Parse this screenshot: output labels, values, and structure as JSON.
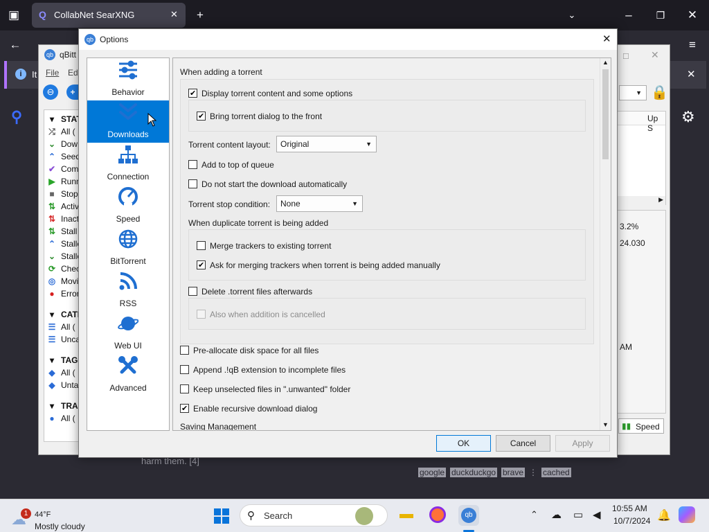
{
  "browser": {
    "tab_title": "CollabNet SearXNG",
    "notice_text": "It",
    "page_fragment": "harm them. [4]",
    "engines": [
      "google",
      "duckduckgo",
      "brave",
      "⋮",
      "cached"
    ]
  },
  "qbt": {
    "title": "qBitt",
    "menu": [
      "File",
      "Edi"
    ],
    "status_header": "STATU",
    "status_items": [
      {
        "icon": "⤮",
        "label": "All (",
        "color": "#555"
      },
      {
        "icon": "⌄",
        "label": "Dow",
        "color": "#2e8b2e"
      },
      {
        "icon": "⌃",
        "label": "Seed",
        "color": "#2a6bd6"
      },
      {
        "icon": "✔",
        "label": "Com",
        "color": "#8a4fd6"
      },
      {
        "icon": "▶",
        "label": "Runn",
        "color": "#2aa52a"
      },
      {
        "icon": "■",
        "label": "Stop",
        "color": "#666"
      },
      {
        "icon": "⇅",
        "label": "Activ",
        "color": "#2a9a2a"
      },
      {
        "icon": "⇅",
        "label": "Inact",
        "color": "#d62a2a"
      },
      {
        "icon": "⇅",
        "label": "Stall",
        "color": "#2a9a2a"
      },
      {
        "icon": "⌃",
        "label": "Stalle",
        "color": "#2a6bd6"
      },
      {
        "icon": "⌄",
        "label": "Stalle",
        "color": "#2e8b2e"
      },
      {
        "icon": "⟳",
        "label": "Chec",
        "color": "#2a9a2a"
      },
      {
        "icon": "◎",
        "label": "Movi",
        "color": "#2a6bd6"
      },
      {
        "icon": "●",
        "label": "Error",
        "color": "#d61f1f"
      }
    ],
    "categories_header": "CATEG",
    "category_items": [
      "All (",
      "Unca"
    ],
    "tags_header": "TAGS",
    "tag_items": [
      "All (",
      "Unta"
    ],
    "trackers_header": "TRACK",
    "tracker_items": [
      "All ("
    ],
    "column_up": "Up S",
    "stat_percent": "3.2%",
    "stat_value": "24.030",
    "stat_time": "AM",
    "speed_label": "Speed"
  },
  "dialog": {
    "title": "Options",
    "close_glyph": "✕",
    "sidebar": [
      {
        "label": "Behavior",
        "icon": "sliders-icon",
        "active": false
      },
      {
        "label": "Downloads",
        "icon": "double-chevron-down-icon",
        "active": true
      },
      {
        "label": "Connection",
        "icon": "network-icon",
        "active": false
      },
      {
        "label": "Speed",
        "icon": "speedometer-icon",
        "active": false
      },
      {
        "label": "BitTorrent",
        "icon": "globe-icon",
        "active": false
      },
      {
        "label": "RSS",
        "icon": "rss-icon",
        "active": false
      },
      {
        "label": "Web UI",
        "icon": "planet-icon",
        "active": false
      },
      {
        "label": "Advanced",
        "icon": "tools-icon",
        "active": false
      }
    ],
    "section_adding": "When adding a torrent",
    "opt_display_content": {
      "label": "Display torrent content and some options",
      "checked": true
    },
    "opt_bring_front": {
      "label": "Bring torrent dialog to the front",
      "checked": true
    },
    "layout_label": "Torrent content layout:",
    "layout_value": "Original",
    "opt_top_queue": {
      "label": "Add to top of queue",
      "checked": false
    },
    "opt_no_start": {
      "label": "Do not start the download automatically",
      "checked": false
    },
    "stop_label": "Torrent stop condition:",
    "stop_value": "None",
    "duplicate_label": "When duplicate torrent is being added",
    "opt_merge": {
      "label": "Merge trackers to existing torrent",
      "checked": false
    },
    "opt_ask_merge": {
      "label": "Ask for merging trackers when torrent is being added manually",
      "checked": true
    },
    "opt_delete_files": {
      "label": "Delete .torrent files afterwards",
      "checked": false
    },
    "opt_also_cancel": {
      "label": "Also when addition is cancelled",
      "checked": false
    },
    "opt_prealloc": {
      "label": "Pre-allocate disk space for all files",
      "checked": false
    },
    "opt_append_ext": {
      "label": "Append .!qB extension to incomplete files",
      "checked": false
    },
    "opt_unwanted": {
      "label": "Keep unselected files in \".unwanted\" folder",
      "checked": false
    },
    "opt_recursive": {
      "label": "Enable recursive download dialog",
      "checked": true
    },
    "section_saving": "Saving Management",
    "btn_ok": "OK",
    "btn_cancel": "Cancel",
    "btn_apply": "Apply"
  },
  "taskbar": {
    "weather_badge": "1",
    "weather_temp": "44°F",
    "weather_desc": "Mostly cloudy",
    "search_placeholder": "Search",
    "time": "10:55 AM",
    "date": "10/7/2024"
  }
}
